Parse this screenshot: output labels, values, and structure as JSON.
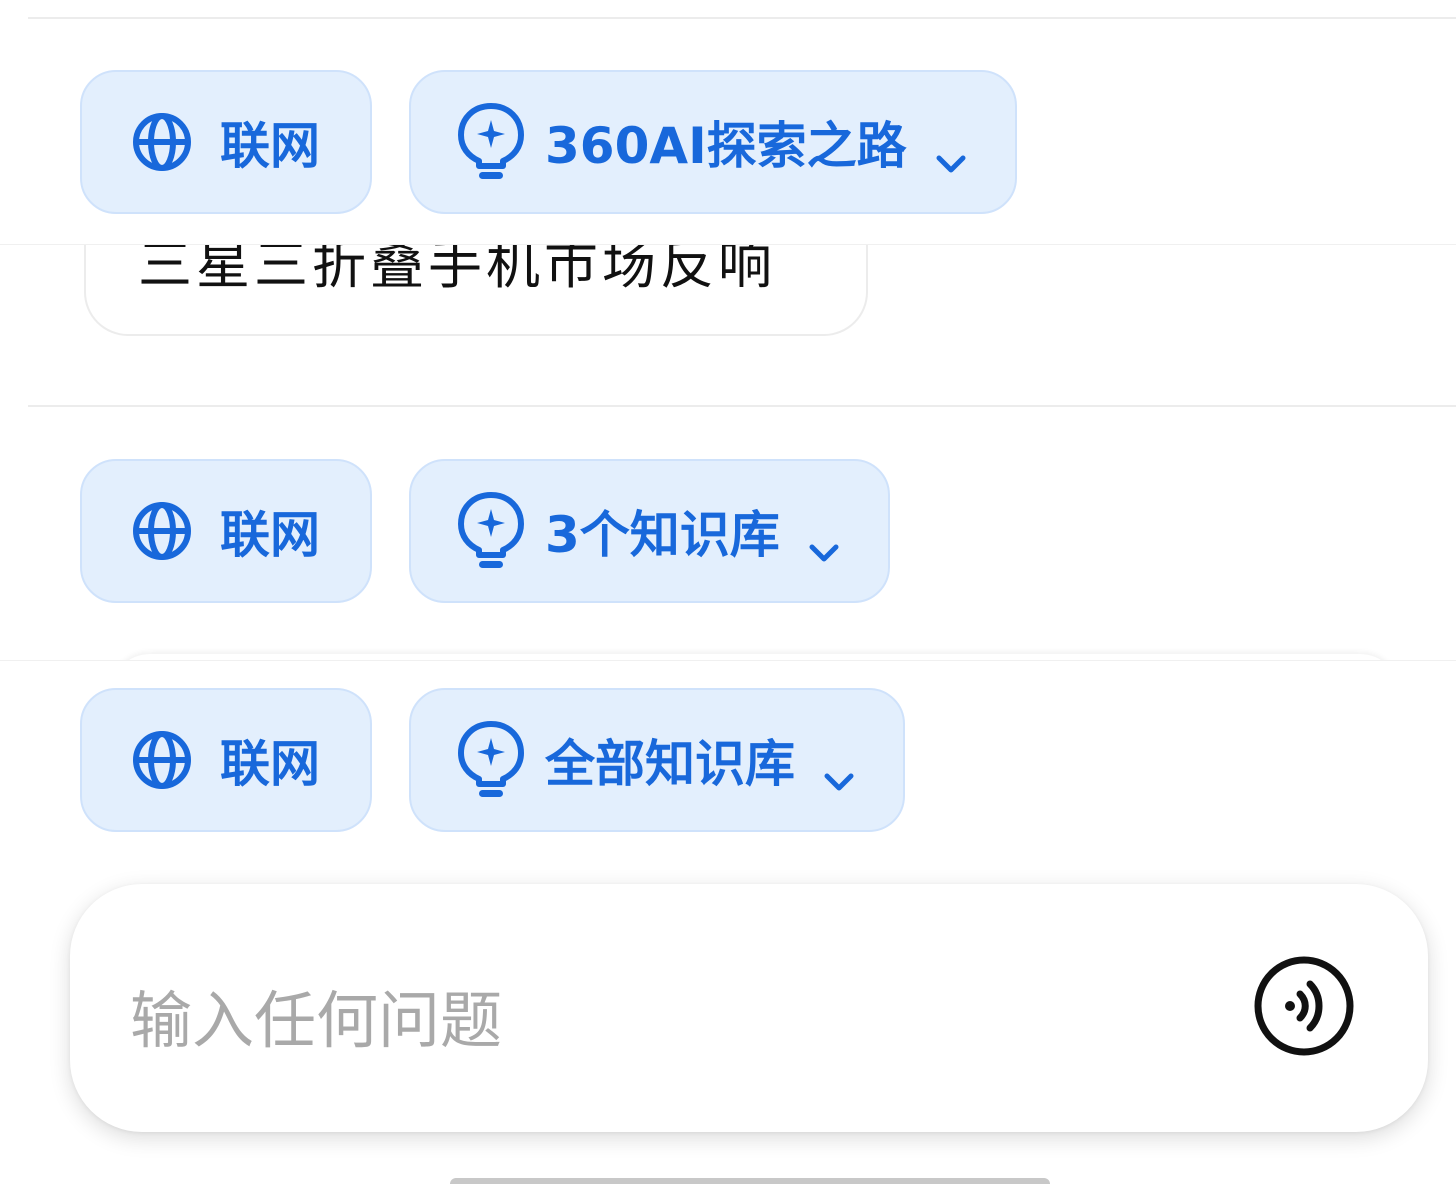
{
  "history_bubble": {
    "text": "三星三折叠手机市场反响"
  },
  "toolbars": [
    {
      "web_label": "联网",
      "kb_label": "360AI探索之路"
    },
    {
      "web_label": "联网",
      "kb_label": "3个知识库"
    },
    {
      "web_label": "联网",
      "kb_label": "全部知识库"
    }
  ],
  "input": {
    "placeholder": "输入任何问题"
  },
  "colors": {
    "accent": "#1868db",
    "chip_bg": "#e3effd",
    "chip_border": "#cfe2fb",
    "placeholder": "#a9a9a9"
  },
  "icons": {
    "web": "globe-icon",
    "kb": "lightbulb-sparkle-icon",
    "dropdown": "chevron-down-icon",
    "voice": "voice-wave-icon"
  }
}
